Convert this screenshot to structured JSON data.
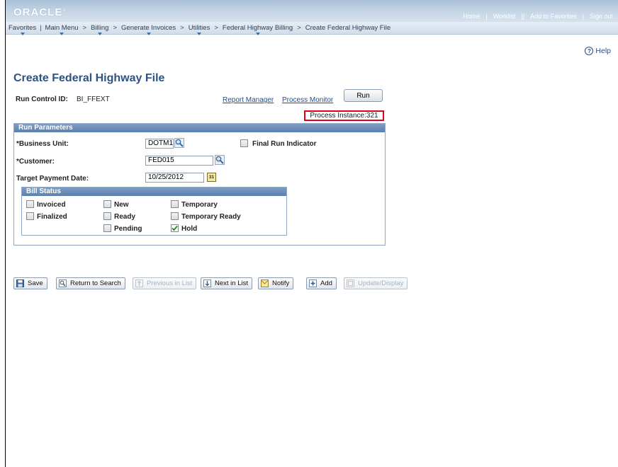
{
  "banner": {
    "logo": "ORACLE",
    "links": [
      "Home",
      "Worklist",
      "Add to Favorites",
      "Sign out"
    ]
  },
  "breadcrumb": {
    "favorites": "Favorites",
    "main_menu": "Main Menu",
    "items": [
      "Billing",
      "Generate Invoices",
      "Utilities",
      "Federal Highway Billing",
      "Create Federal Highway File"
    ]
  },
  "help": "Help",
  "page_title": "Create Federal Highway File",
  "run_control": {
    "label": "Run Control ID:",
    "value": "BI_FFEXT"
  },
  "links": {
    "report_manager": "Report Manager",
    "process_monitor": "Process Monitor"
  },
  "run_button": "Run",
  "process_instance": "Process Instance:321",
  "run_parameters": {
    "header": "Run Parameters",
    "business_unit_label": "*Business Unit:",
    "business_unit_value": "DOTM1",
    "final_run_label": "Final Run Indicator",
    "customer_label": "*Customer:",
    "customer_value": "FED015",
    "target_date_label": "Target Payment Date:",
    "target_date_value": "10/25/2012",
    "calendar_glyph": "31"
  },
  "bill_status": {
    "header": "Bill Status",
    "invoiced": "Invoiced",
    "finalized": "Finalized",
    "new": "New",
    "ready": "Ready",
    "pending": "Pending",
    "temporary": "Temporary",
    "temporary_ready": "Temporary Ready",
    "hold": "Hold"
  },
  "toolbar": {
    "save": "Save",
    "return_to_search": "Return to Search",
    "previous_in_list": "Previous in List",
    "next_in_list": "Next in List",
    "notify": "Notify",
    "add": "Add",
    "update_display": "Update/Display"
  },
  "colors": {
    "title": "#2d5381",
    "highlight_box": "#e0001a",
    "group_header": "#5b80ad"
  }
}
